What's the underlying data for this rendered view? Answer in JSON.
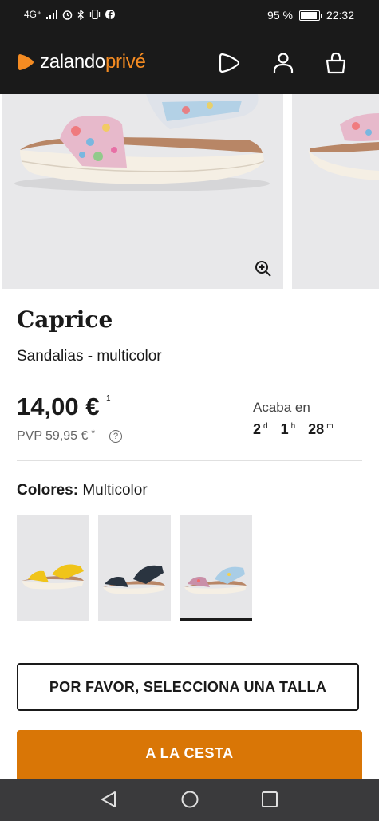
{
  "status_bar": {
    "network": "4G⁺",
    "battery_percent": "95 %",
    "battery_level": 0.95,
    "time": "22:32"
  },
  "header": {
    "logo_main": "zalando",
    "logo_accent": "privé",
    "icons": [
      "play-icon",
      "user-icon",
      "bag-icon"
    ]
  },
  "product": {
    "brand": "Caprice",
    "description": "Sandalias - multicolor",
    "price": "14,00 €",
    "price_note": "1",
    "pvp_label": "PVP",
    "pvp_old_price": "59,95 €",
    "pvp_star": "*",
    "help_symbol": "?"
  },
  "countdown": {
    "label": "Acaba en",
    "days": "2",
    "days_unit": "d",
    "hours": "1",
    "hours_unit": "h",
    "minutes": "28",
    "minutes_unit": "m"
  },
  "colors": {
    "label": "Colores:",
    "value": "Multicolor",
    "swatches": [
      {
        "name": "yellow",
        "color": "#f0c419",
        "selected": false
      },
      {
        "name": "navy",
        "color": "#2a3440",
        "selected": false
      },
      {
        "name": "multicolor",
        "color": "#c98fa8",
        "selected": true
      }
    ]
  },
  "actions": {
    "select_size": "POR FAVOR, SELECCIONA UNA TALLA",
    "add_to_cart": "A LA CESTA"
  },
  "theme": {
    "accent": "#d97606",
    "logo_orange": "#f48b22",
    "dark": "#1a1a1a"
  }
}
